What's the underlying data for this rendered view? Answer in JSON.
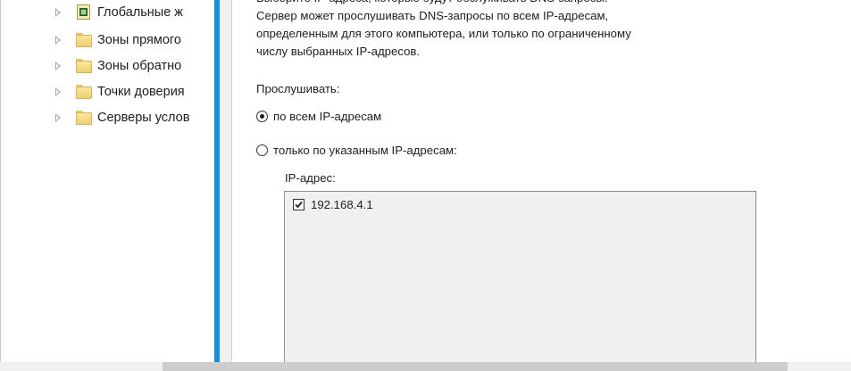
{
  "tree": {
    "items": [
      {
        "label": "Глобальные ж",
        "icon": "global-logs-icon"
      },
      {
        "label": "Зоны прямого",
        "icon": "folder-icon"
      },
      {
        "label": "Зоны обратно",
        "icon": "folder-icon"
      },
      {
        "label": "Точки доверия",
        "icon": "folder-icon"
      },
      {
        "label": "Серверы услов",
        "icon": "folder-icon"
      }
    ]
  },
  "dialog": {
    "desc_top": "Выберите IP-адреса, которые будут обслуживать DNS-запросы.",
    "desc_1": "Сервер может прослушивать DNS-запросы по всем IP-адресам,",
    "desc_2": "определенным для этого компьютера, или только по ограниченному",
    "desc_3": "числу выбранных IP-адресов.",
    "listen_label": "Прослушивать:",
    "radio_all": "по всем IP-адресам",
    "radio_all_selected": true,
    "radio_specific": "только по указанным IP-адресам:",
    "ip_header": "IP-адрес:",
    "ip_addresses": [
      {
        "address": "192.168.4.1",
        "checked": true
      }
    ]
  },
  "colors": {
    "splitter": "#1a8fd8",
    "list_background": "#f0f0f0"
  }
}
